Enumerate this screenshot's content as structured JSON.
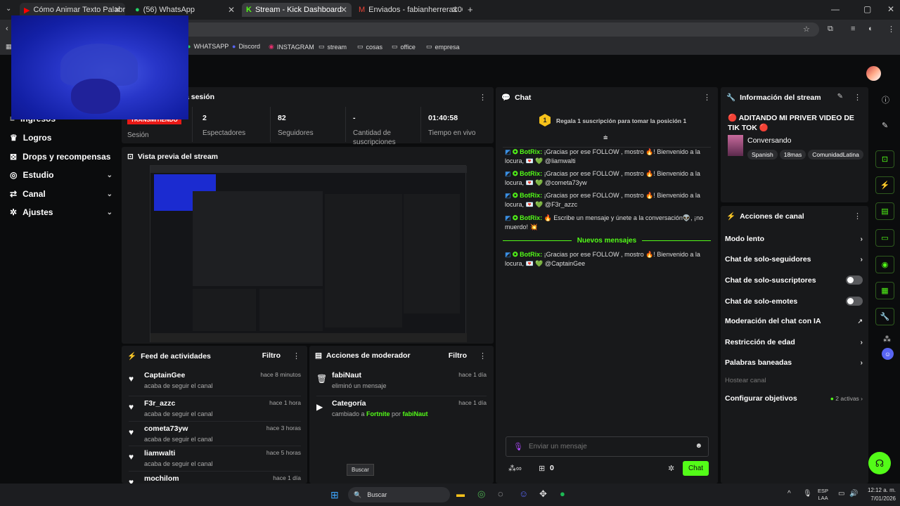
{
  "browser": {
    "tabs": [
      {
        "label": "Cómo Animar Texto Palabra po"
      },
      {
        "label": "(56) WhatsApp"
      },
      {
        "label": "Stream - Kick Dashboard"
      },
      {
        "label": "Enviados - fabianherrera1005@"
      }
    ],
    "bookmarks": [
      "WHATSAPP",
      "Discord",
      "INSTAGRAM",
      "stream",
      "cosas",
      "office",
      "empresa"
    ]
  },
  "sidebar": {
    "items": [
      {
        "label": "Ingresos"
      },
      {
        "label": "Logros"
      },
      {
        "label": "Drops y recompensas"
      },
      {
        "label": "Estudio"
      },
      {
        "label": "Canal"
      },
      {
        "label": "Ajustes"
      }
    ]
  },
  "session": {
    "title": "a sesión",
    "live_badge": "TRANSMITIENDO",
    "stats": [
      {
        "value": "",
        "label": "Sesión"
      },
      {
        "value": "2",
        "label": "Espectadores"
      },
      {
        "value": "82",
        "label": "Seguidores"
      },
      {
        "value": "-",
        "label": "Cantidad de suscripciones"
      },
      {
        "value": "01:40:58",
        "label": "Tiempo en vivo"
      }
    ]
  },
  "preview": {
    "title": "Vista previa del stream"
  },
  "feed": {
    "title": "Feed de actividades",
    "filter": "Filtro",
    "items": [
      {
        "name": "CaptainGee",
        "desc": "acaba de seguir el canal",
        "time": "hace 8 minutos"
      },
      {
        "name": "F3r_azzc",
        "desc": "acaba de seguir el canal",
        "time": "hace 1 hora"
      },
      {
        "name": "cometa73yw",
        "desc": "acaba de seguir el canal",
        "time": "hace 3 horas"
      },
      {
        "name": "liamwalti",
        "desc": "acaba de seguir el canal",
        "time": "hace 5 horas"
      },
      {
        "name": "mochilom",
        "desc": "",
        "time": "hace 1 día"
      }
    ]
  },
  "mod": {
    "title": "Acciones de moderador",
    "filter": "Filtro",
    "items": [
      {
        "name": "fabiNaut",
        "desc": "eliminó un mensaje",
        "time": "hace 1 día"
      },
      {
        "name": "Categoría",
        "desc_pre": "cambiado a ",
        "game": "Fortnite",
        "desc_mid": " por ",
        "user": "fabiNaut",
        "time": "hace 1 día"
      }
    ]
  },
  "chat": {
    "title": "Chat",
    "gift_rank": "1",
    "gift_text": "Regala 1 suscripción para tomar la posición 1",
    "messages": [
      {
        "user": "BotRix:",
        "text": " ¡Gracias por ese FOLLOW , mostro 🔥! Bienvenido a la locura, 💌 💚 @liamwalti"
      },
      {
        "user": "BotRix:",
        "text": " ¡Gracias por ese FOLLOW , mostro 🔥! Bienvenido a la locura, 💌 💚 @cometa73yw"
      },
      {
        "user": "BotRix:",
        "text": " ¡Gracias por ese FOLLOW , mostro 🔥! Bienvenido a la locura, 💌 💚 @F3r_azzc"
      },
      {
        "user": "BotRix:",
        "text": " 🔥 Escribe un mensaje y únete a la conversación👽, ¡no muerdo! 💥"
      }
    ],
    "new_label": "Nuevos mensajes",
    "new_message": {
      "user": "BotRix:",
      "text": " ¡Gracias por ese FOLLOW , mostro 🔥! Bienvenido a la locura, 💌 💚 @CaptainGee"
    },
    "input_placeholder": "Enviar un mensaje",
    "count": "0",
    "send": "Chat"
  },
  "info": {
    "title": "Información del stream",
    "stream_title": "🔴 ADITANDO MI PRIVER VIDEO DE TIK TOK 🔴",
    "category": "Conversando",
    "tags": [
      "Spanish",
      "18mas",
      "ComunidadLatina"
    ]
  },
  "actions": {
    "title": "Acciones de canal",
    "items": [
      {
        "label": "Modo lento",
        "kind": "chevron"
      },
      {
        "label": "Chat de solo-seguidores",
        "kind": "chevron"
      },
      {
        "label": "Chat de solo-suscriptores",
        "kind": "toggle"
      },
      {
        "label": "Chat de solo-emotes",
        "kind": "toggle"
      },
      {
        "label": "Moderación del chat con IA",
        "kind": "ext"
      },
      {
        "label": "Restricción de edad",
        "kind": "chevron"
      },
      {
        "label": "Palabras baneadas",
        "kind": "chevron"
      },
      {
        "label": "Hostear canal",
        "kind": "none"
      },
      {
        "label": "Configurar objetivos",
        "kind": "chevron"
      }
    ],
    "goals_active": "2 activas"
  },
  "tooltip": "Buscar",
  "taskbar": {
    "search": "Buscar",
    "lang1": "ESP",
    "lang2": "LAA",
    "time": "12:12 a. m.",
    "date": "7/01/2026"
  },
  "colors": {
    "accent": "#53fc18",
    "live": "#e91916"
  }
}
